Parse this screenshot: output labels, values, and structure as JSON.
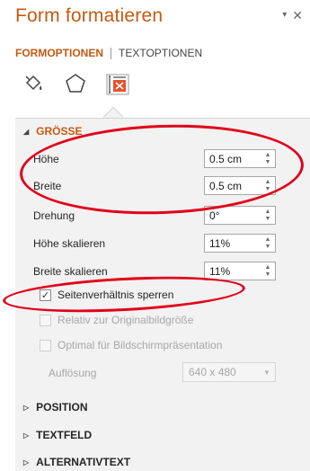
{
  "pane": {
    "title": "Form formatieren",
    "pin_glyph": "▾",
    "close_glyph": "✕"
  },
  "tabs": [
    {
      "label": "FORMOPTIONEN",
      "active": true
    },
    {
      "label": "TEXTOPTIONEN",
      "active": false
    }
  ],
  "icons": [
    "fill-line-icon",
    "effects-icon",
    "size-properties-icon"
  ],
  "size_section": {
    "header": "GRÖSSE",
    "fields": [
      {
        "label": "Höhe",
        "value": "0.5  cm"
      },
      {
        "label": "Breite",
        "value": "0.5  cm"
      },
      {
        "label": "Drehung",
        "value": "0°"
      },
      {
        "label": "Höhe skalieren",
        "value": "11%"
      },
      {
        "label": "Breite skalieren",
        "value": "11%"
      }
    ],
    "checkboxes": [
      {
        "label": "Seitenverhältnis sperren",
        "checked": true,
        "enabled": true
      },
      {
        "label": "Relativ zur Originalbildgröße",
        "checked": false,
        "enabled": false
      },
      {
        "label": "Optimal für Bildschirmpräsentation",
        "checked": false,
        "enabled": false
      }
    ],
    "resolution": {
      "label": "Auflösung",
      "value": "640 x 480"
    }
  },
  "collapsed_sections": [
    "POSITION",
    "TEXTFELD",
    "ALTERNATIVTEXT"
  ],
  "colors": {
    "accent": "#c55a11",
    "annotation": "#e2001a",
    "panel_bg": "#f2f2f2"
  }
}
